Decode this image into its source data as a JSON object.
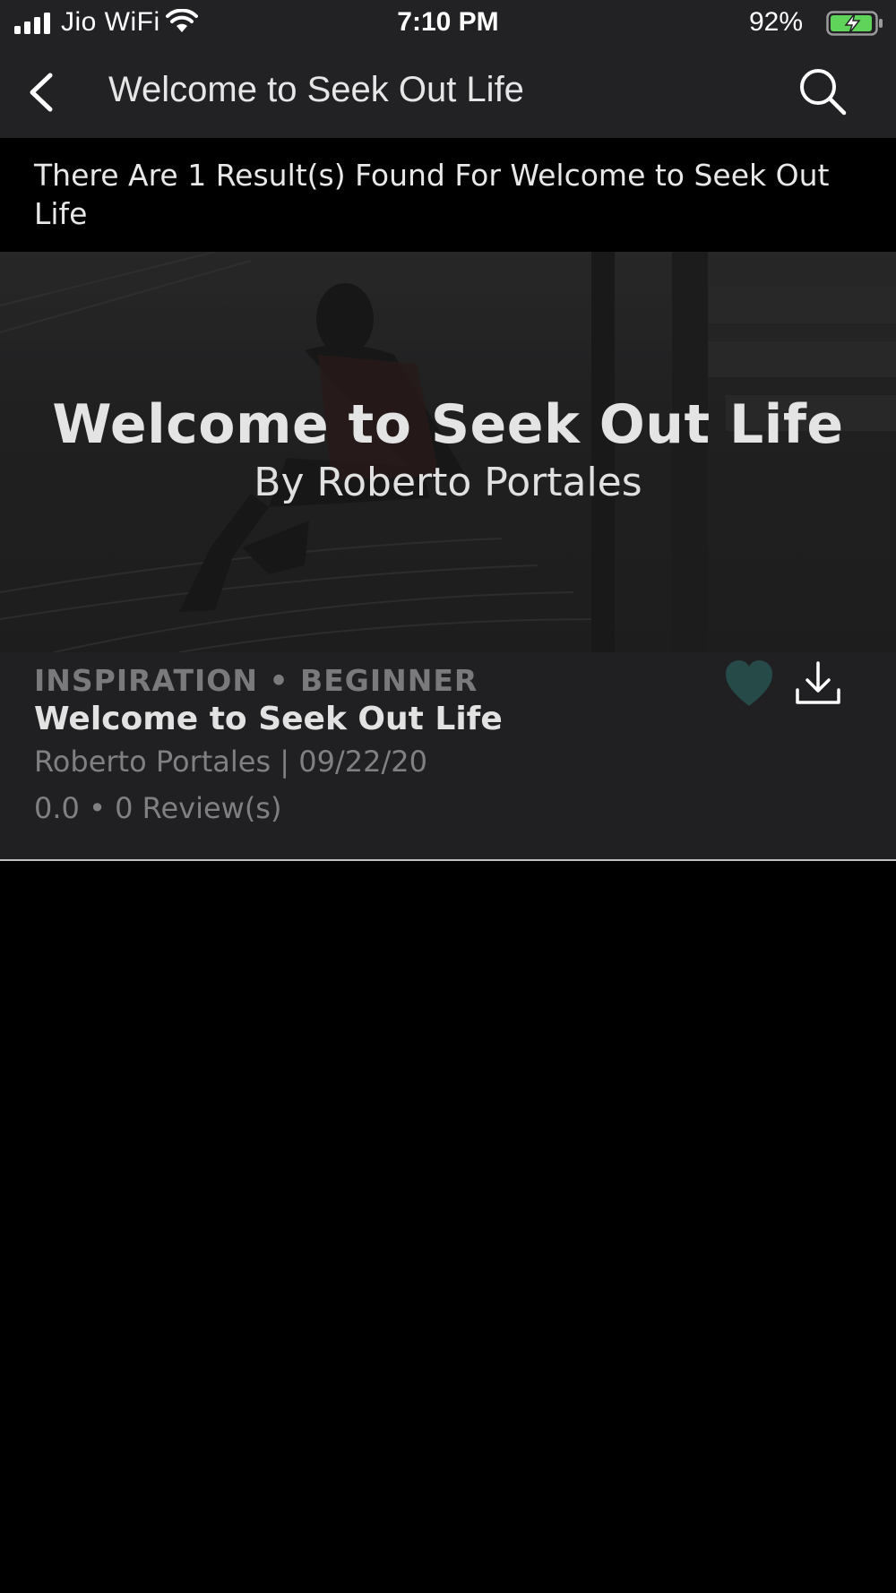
{
  "status_bar": {
    "carrier": "Jio WiFi",
    "time": "7:10 PM",
    "battery_percent": "92%",
    "icons": [
      "signal-icon",
      "wifi-icon",
      "battery-charging-icon"
    ]
  },
  "nav": {
    "title": "Welcome to Seek Out Life",
    "back_icon": "chevron-left-icon",
    "search_icon": "search-icon"
  },
  "results": {
    "summary": "There Are 1 Result(s) Found For Welcome to Seek Out Life"
  },
  "hero": {
    "title": "Welcome to Seek Out Life",
    "subtitle": "By Roberto Portales"
  },
  "item": {
    "category": "INSPIRATION • BEGINNER",
    "title": "Welcome to Seek Out Life",
    "meta": "Roberto Portales | 09/22/20",
    "rating": "0.0 • 0 Review(s)",
    "favorite_icon": "heart-icon",
    "download_icon": "download-icon"
  },
  "colors": {
    "bar_background": "#222225",
    "page_background": "#000000",
    "card_background": "#202023",
    "heart_accent": "#264a48",
    "battery_green": "#5fd35a"
  }
}
